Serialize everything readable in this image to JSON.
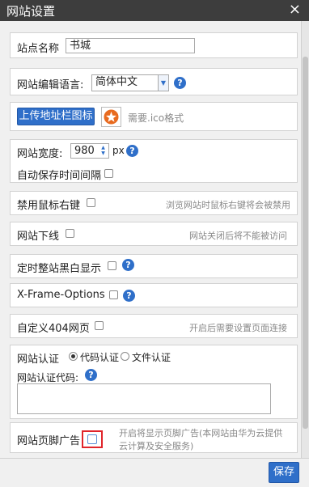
{
  "window": {
    "title": "网站设置",
    "close_glyph": "×"
  },
  "site_name": {
    "label": "站点名称",
    "value": "书城"
  },
  "language": {
    "label": "网站编辑语言:",
    "value": "简体中文"
  },
  "favicon": {
    "button_label": "上传地址栏图标",
    "hint": "需要.ico格式"
  },
  "width": {
    "label": "网站宽度:",
    "value": "980",
    "unit": "px"
  },
  "autosave": {
    "label": "自动保存时间间隔"
  },
  "disable_right_click": {
    "label": "禁用鼠标右键",
    "hint": "浏览网站时鼠标右键将会被禁用"
  },
  "offline": {
    "label": "网站下线",
    "hint": "网站关闭后将不能被访问"
  },
  "grayscale": {
    "label": "定时整站黑白显示"
  },
  "xframe": {
    "label": "X-Frame-Options"
  },
  "custom404": {
    "label": "自定义404网页",
    "hint": "开启后需要设置页面连接"
  },
  "verify": {
    "label": "网站认证",
    "option_code": "代码认证",
    "option_file": "文件认证",
    "code_label": "网站认证代码:",
    "code_value": ""
  },
  "footer_ad": {
    "label": "网站页脚广告",
    "hint_line1": "开启将显示页脚广告(本网站由华为云提供",
    "hint_line2": "云计算及安全服务)"
  },
  "buttons": {
    "save": "保存"
  },
  "colors": {
    "accent": "#2f6fc9",
    "titlebar": "#3d3d3d",
    "highlight": "#e0242a"
  }
}
